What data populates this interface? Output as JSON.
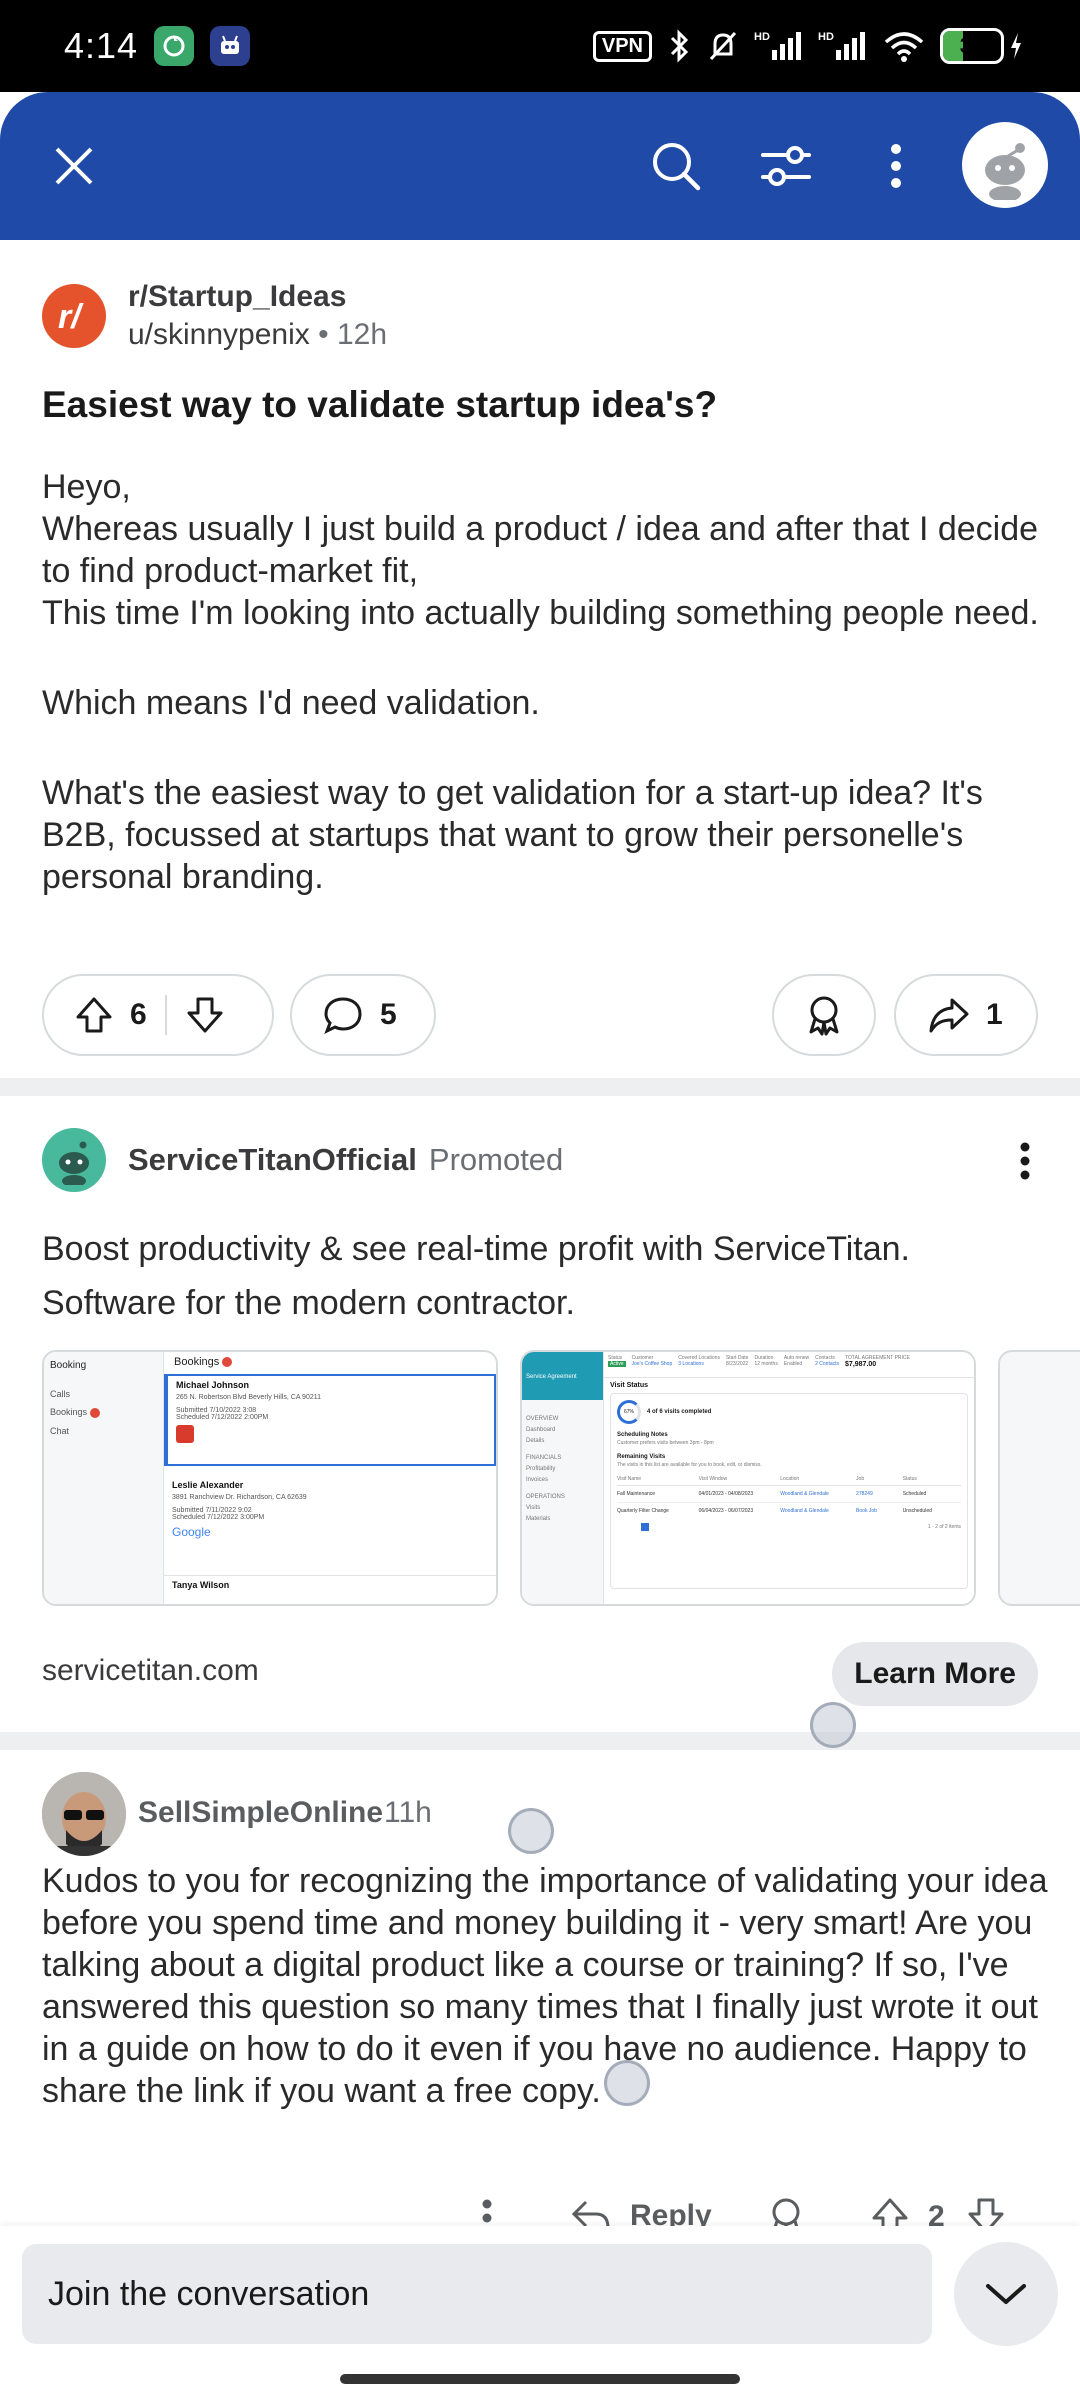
{
  "status_bar": {
    "time": "4:14",
    "vpn": "VPN",
    "battery": "35",
    "battery_fraction": 0.35
  },
  "app_bar": {
    "icons": [
      "close-icon",
      "search-icon",
      "filter-icon",
      "more-vert-icon",
      "user-avatar"
    ]
  },
  "post": {
    "subreddit": "r/Startup_Ideas",
    "user": "u/skinnypenix",
    "age": "12h",
    "title": "Easiest way to validate startup idea's?",
    "body": [
      "Heyo,",
      "Whereas usually I just build a product / idea and after that I decide to find product-market fit,",
      "This time I'm looking into actually building something people need.",
      "",
      "Which means I'd need validation.",
      "",
      "What's the easiest way to get validation for a start-up idea? It's B2B, focussed at startups that want to grow their personelle's personal branding."
    ],
    "votes": "6",
    "comments": "5",
    "shares": "1"
  },
  "ad": {
    "advertiser": "ServiceTitanOfficial",
    "promoted": "Promoted",
    "text": "Boost productivity & see real-time profit with ServiceTitan. Software for the modern contractor.",
    "domain": "servicetitan.com",
    "cta": "Learn More",
    "card1": {
      "sidebar_title": "Booking",
      "sidebar_items": [
        "Calls",
        "Bookings",
        "Chat"
      ],
      "header": "Bookings",
      "entries": [
        {
          "name": "Michael Johnson",
          "address": "265 N. Robertson Blvd Beverly Hills, CA 90211",
          "submitted": "Submitted 7/10/2022 3:08",
          "scheduled": "Scheduled 7/12/2022 2:00PM"
        },
        {
          "name": "Leslie Alexander",
          "address": "3891 Ranchview Dr. Richardson, CA 62639",
          "submitted": "Submitted 7/11/2022 9:02",
          "scheduled": "Scheduled 7/12/2022 3:00PM"
        },
        {
          "name": "Tanya Wilson",
          "address": "",
          "submitted": "",
          "scheduled": ""
        }
      ],
      "google": "Google"
    },
    "card2": {
      "header_cols": [
        "Status",
        "Customer",
        "Covered Locations",
        "Start Date",
        "Duration",
        "Auto renew",
        "Contacts",
        "TOTAL AGREEMENT PRICE"
      ],
      "header_vals": [
        "Active",
        "Joe's Coffee Shop",
        "3 Locations",
        "8/23/2022",
        "12 months",
        "Enabled",
        "2 Contacts",
        "$7,987.00"
      ],
      "sidebar_active": "Service Agreement",
      "sidebar_items": [
        "OVERVIEW",
        "Dashboard",
        "Details",
        "FINANCIALS",
        "Profitability",
        "Invoices",
        "OPERATIONS",
        "Visits",
        "Materials"
      ],
      "visit_status": "Visit Status",
      "progress": "67%",
      "progress_label": "4 of 6 visits completed",
      "sched_title": "Scheduling Notes",
      "sched_text": "Customer prefers visits between 3pm - 8pm",
      "remaining_title": "Remaining Visits",
      "remaining_text": "The visits in this list are available for you to book, edit, or dismiss.",
      "table_cols": [
        "Visit Name",
        "Visit Window",
        "Location",
        "Job",
        "Status"
      ],
      "rows": [
        [
          "Fall Maintenance",
          "04/01/2023 - 04/08/2023",
          "Woodland & Glendale",
          "278249",
          "Scheduled"
        ],
        [
          "Quarterly Filter Change",
          "06/04/2023 - 06/07/2023",
          "Woodland & Glendale",
          "Book Job",
          "Unscheduled"
        ]
      ],
      "pagination": "1 - 2 of 2 items"
    }
  },
  "comment": {
    "user": "SellSimpleOnline",
    "age": "11h",
    "body": "Kudos to you for recognizing the importance of validating your idea before you spend time and money building it - very smart! Are you talking about a digital product like a course or training? If so, I've answered this question so many times that I finally just wrote it out in a guide on how to do it even if you have no audience. Happy to share the link if you want a free copy.",
    "reply": "Reply",
    "votes": "2"
  },
  "bottom": {
    "placeholder": "Join the conversation"
  }
}
